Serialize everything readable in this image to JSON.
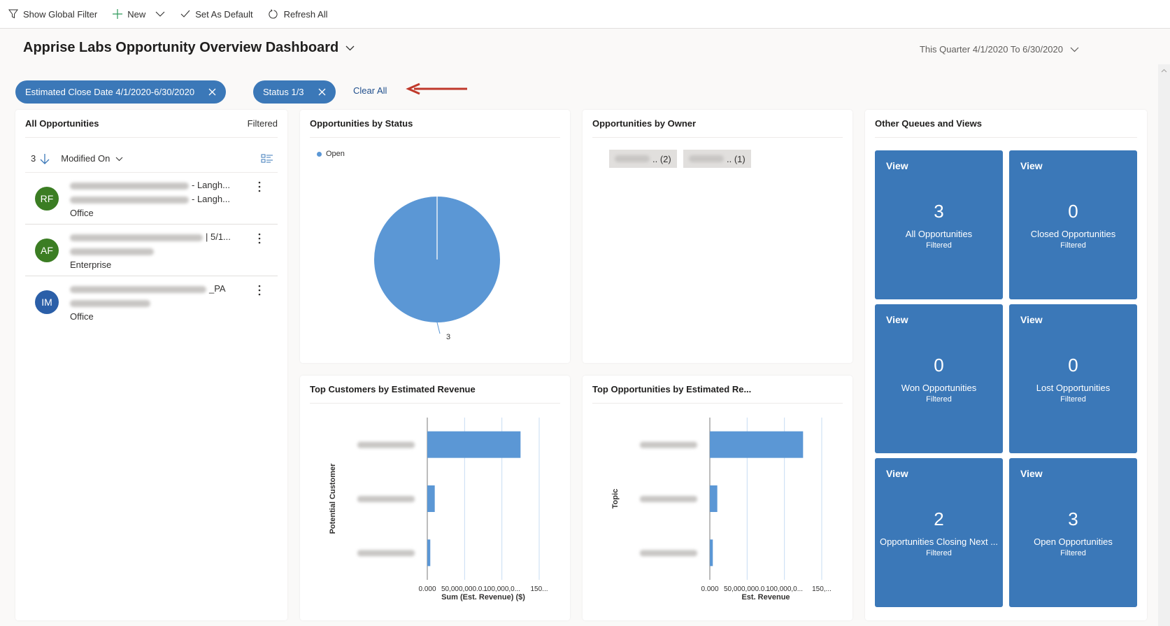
{
  "commandbar": {
    "show_global_filter": "Show Global Filter",
    "new": "New",
    "set_as_default": "Set As Default",
    "refresh_all": "Refresh All"
  },
  "header": {
    "title": "Apprise Labs Opportunity Overview Dashboard",
    "period": "This Quarter 4/1/2020 To 6/30/2020"
  },
  "filters": {
    "chips": [
      {
        "label": "Estimated Close Date 4/1/2020-6/30/2020"
      },
      {
        "label": "Status 1/3"
      }
    ],
    "clear_all": "Clear All"
  },
  "all_opportunities": {
    "title": "All Opportunities",
    "filtered": "Filtered",
    "count": "3",
    "sort_field": "Modified On",
    "rows": [
      {
        "initials": "RF",
        "color": "#3b7d23",
        "line1_suffix": "- Langh...",
        "line2_suffix": "- Langh...",
        "line3": "Office"
      },
      {
        "initials": "AF",
        "color": "#3b7d23",
        "line1_suffix": "| 5/1...",
        "line2_suffix": "",
        "line3": "Enterprise"
      },
      {
        "initials": "IM",
        "color": "#2b5fa8",
        "line1_suffix": "_PA",
        "line2_suffix": "",
        "line3": "Office"
      }
    ]
  },
  "status_chart": {
    "title": "Opportunities by Status",
    "legend": "Open",
    "slice_label": "3"
  },
  "owner_chart": {
    "title": "Opportunities by Owner",
    "owners": [
      {
        "label": ".. (2)"
      },
      {
        "label": ".. (1)"
      }
    ]
  },
  "customers_chart": {
    "title": "Top Customers by Estimated Revenue",
    "ylabel": "Potential Customer",
    "xlabel": "Sum (Est. Revenue) ($)",
    "ticks": [
      "0.000",
      "50,000,000.0...",
      "100,000,0...",
      "150..."
    ]
  },
  "topopps_chart": {
    "title": "Top Opportunities by Estimated Re...",
    "ylabel": "Topic",
    "xlabel": "Est. Revenue",
    "ticks": [
      "0.000",
      "50,000,000.0...",
      "100,000,0...",
      "150,..."
    ]
  },
  "queues": {
    "title": "Other Queues and Views",
    "tiles": [
      {
        "view": "View",
        "count": "3",
        "name": "All Opportunities",
        "sub": "Filtered"
      },
      {
        "view": "View",
        "count": "0",
        "name": "Closed Opportunities",
        "sub": "Filtered"
      },
      {
        "view": "View",
        "count": "0",
        "name": "Won Opportunities",
        "sub": "Filtered"
      },
      {
        "view": "View",
        "count": "0",
        "name": "Lost Opportunities",
        "sub": "Filtered"
      },
      {
        "view": "View",
        "count": "2",
        "name": "Opportunities Closing Next ...",
        "sub": "Filtered"
      },
      {
        "view": "View",
        "count": "3",
        "name": "Open Opportunities",
        "sub": "Filtered"
      }
    ]
  },
  "colors": {
    "accent": "#3b78b8",
    "chart_blue": "#5b97d5",
    "arrow": "#c0392b"
  },
  "chart_data": [
    {
      "type": "pie",
      "title": "Opportunities by Status",
      "categories": [
        "Open"
      ],
      "values": [
        3
      ],
      "legend": "top-left"
    },
    {
      "type": "bar",
      "orientation": "horizontal",
      "title": "Top Customers by Estimated Revenue",
      "xlabel": "Sum (Est. Revenue) ($)",
      "ylabel": "Potential Customer",
      "categories": [
        "(customer 1)",
        "(customer 2)",
        "(customer 3)"
      ],
      "values": [
        125000000,
        10000000,
        4000000
      ],
      "xlim": [
        0,
        150000000
      ],
      "xticks": [
        0,
        50000000,
        100000000,
        150000000
      ]
    },
    {
      "type": "bar",
      "orientation": "horizontal",
      "title": "Top Opportunities by Estimated Re...",
      "xlabel": "Est. Revenue",
      "ylabel": "Topic",
      "categories": [
        "(topic 1)",
        "(topic 2)",
        "(topic 3)"
      ],
      "values": [
        125000000,
        10000000,
        4000000
      ],
      "xlim": [
        0,
        150000000
      ],
      "xticks": [
        0,
        50000000,
        100000000,
        150000000
      ]
    }
  ]
}
